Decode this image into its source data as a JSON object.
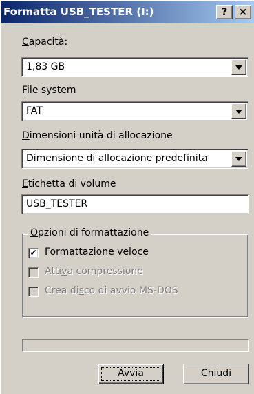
{
  "window": {
    "title": "Formatta USB_TESTER (I:)",
    "help_label": "?",
    "close_label": "×"
  },
  "capacity": {
    "label_hotkey": "C",
    "label_rest": "apacità:",
    "value": "1,83 GB"
  },
  "filesystem": {
    "label_hotkey": "F",
    "label_rest": "ile system",
    "value": "FAT"
  },
  "allocation": {
    "label_hotkey": "D",
    "label_rest": "imensioni unità di allocazione",
    "value": "Dimensione di allocazione predefinita"
  },
  "volume": {
    "label_hotkey": "E",
    "label_rest": "tichetta di volume",
    "value": "USB_TESTER"
  },
  "options": {
    "group_hotkey": "O",
    "group_rest": "pzioni di formattazione",
    "quick_format": {
      "pre": "For",
      "hotkey": "m",
      "post": "attazione veloce",
      "checked": true,
      "check_glyph": "✔"
    },
    "compression": {
      "pre": "Atti",
      "hotkey": "v",
      "post": "a compressione",
      "checked": false
    },
    "boot_disk": {
      "pre": "Crea di",
      "hotkey": "s",
      "post": "co di avvio MS-DOS",
      "checked": false
    }
  },
  "progress": {
    "value": 0
  },
  "buttons": {
    "start": {
      "hotkey": "A",
      "rest": "vvia"
    },
    "close": {
      "pre": "C",
      "hotkey": "h",
      "post": "iudi"
    }
  }
}
